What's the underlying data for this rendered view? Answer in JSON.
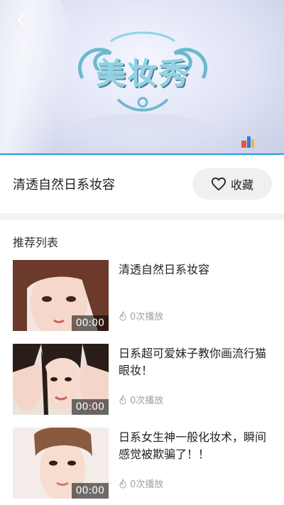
{
  "player": {
    "logo_text": "美妆秀"
  },
  "video": {
    "title": "清透自然日系妆容",
    "favorite_label": "收藏"
  },
  "recommend": {
    "heading": "推荐列表",
    "items": [
      {
        "title": "清透自然日系妆容",
        "duration": "00:00",
        "plays": "0次播放"
      },
      {
        "title": "日系超可爱妹子教你画流行猫眼妆！",
        "duration": "00:00",
        "plays": "0次播放"
      },
      {
        "title": "日系女生神一般化妆术，瞬间感觉被欺骗了！！",
        "duration": "00:00",
        "plays": "0次播放"
      }
    ]
  },
  "colors": {
    "accent": "#1aa2d8",
    "favorite_bg": "#f0f0f0",
    "meta_text": "#a0a0a0"
  },
  "icons": [
    "back-arrow-icon",
    "heart-outline-icon",
    "fire-icon"
  ]
}
